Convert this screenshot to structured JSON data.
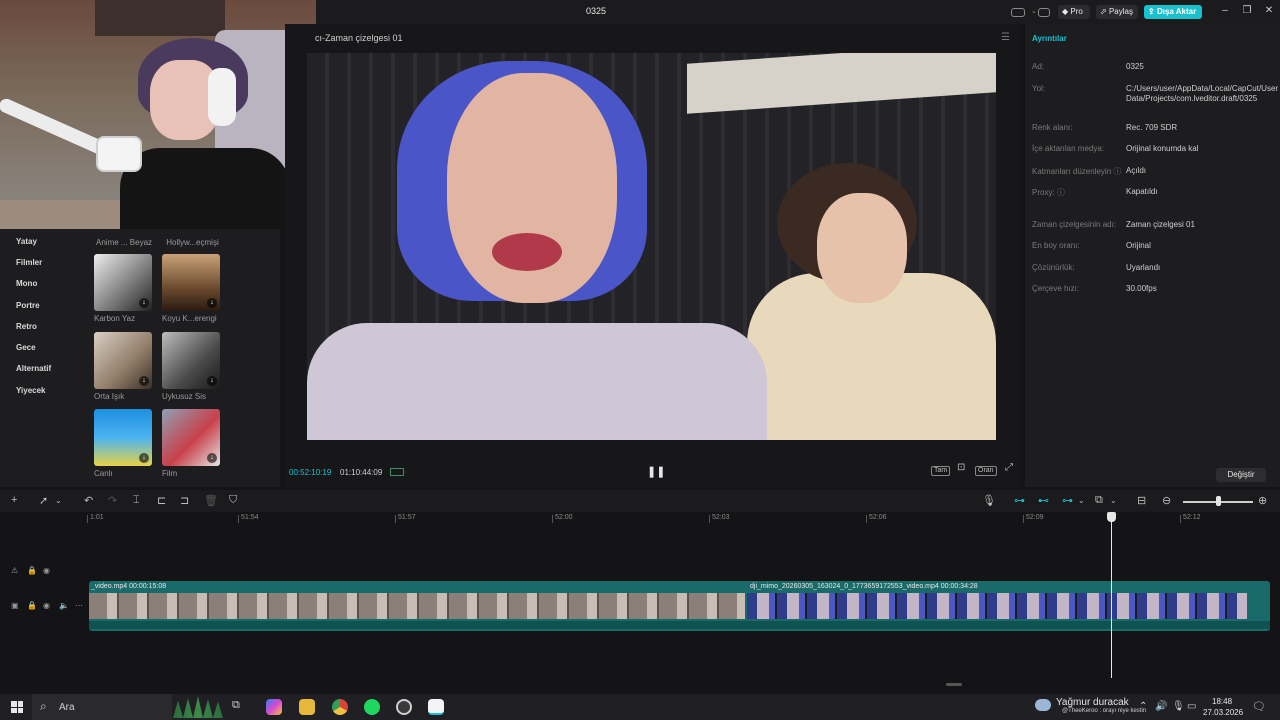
{
  "titlebar": {
    "title": "0325",
    "pro_label": "Pro",
    "share_label": "Paylaş",
    "export_label": "Dışa Aktar",
    "pro_icon": "diamond-icon",
    "share_icon": "share-icon",
    "export_icon": "export-icon"
  },
  "colors": {
    "accent": "#19c1cf",
    "background": "#141416",
    "panel": "#1d1d20"
  },
  "left_panel": {
    "top_labels": [
      "Anime ... Beyaz",
      "Hollyw...eçmişi"
    ],
    "categories": [
      "Yatay",
      "Filmler",
      "Mono",
      "Portre",
      "Retro",
      "Gece",
      "Alternatif",
      "Yiyecek"
    ],
    "filters": [
      {
        "label": "Karbon Yaz"
      },
      {
        "label": "Koyu K...erengi"
      },
      {
        "label": "Orta Işık"
      },
      {
        "label": "Uykusuz Sis"
      },
      {
        "label": "Canlı"
      },
      {
        "label": "Film"
      }
    ]
  },
  "player": {
    "title": "cı-Zaman çizelgesi 01",
    "current_time": "00:52:10:19",
    "total_time": "01:10:44:09",
    "full_label": "Tam",
    "ratio_label": "Oran"
  },
  "details": {
    "heading": "Ayrıntılar",
    "rows": [
      {
        "label": "Ad:",
        "value": "0325"
      },
      {
        "label": "Yol:",
        "value": "C:/Users/user/AppData/Local/CapCut/User Data/Projects/com.lveditor.draft/0325"
      },
      {
        "label": "Renk alanı:",
        "value": "Rec. 709 SDR"
      },
      {
        "label": "İçe aktarılan medya:",
        "value": "Orijinal konumda kal"
      },
      {
        "label": "Katmanları düzenleyin ⓘ",
        "value": "Açıldı"
      },
      {
        "label": "Proxy: ⓘ",
        "value": "Kapatıldı"
      },
      {
        "label": "Zaman çizelgesinin adı:",
        "value": "Zaman çizelgesi 01"
      },
      {
        "label": "En boy oranı:",
        "value": "Orijinal"
      },
      {
        "label": "Çözünürlük:",
        "value": "Uyarlandı"
      },
      {
        "label": "Çerçeve hızı:",
        "value": "30.00fps"
      }
    ],
    "change_label": "Değiştir"
  },
  "timeline": {
    "ruler_ticks": [
      "1:01",
      "51:54",
      "51:57",
      "52:00",
      "52:03",
      "52:06",
      "52:09",
      "52:12"
    ],
    "clip1_label": "_video.mp4   00:00:15:08",
    "clip2_label": "dji_mimo_20260305_163024_0_1773659172553_video.mp4   00:00:34:28"
  },
  "taskbar": {
    "search_text": "Ara",
    "weather_text": "Yağmur duracak",
    "weather_sub": "@TheeKeroo : orayı niye kestin",
    "time": "18:48",
    "date": "27.03.2026"
  }
}
